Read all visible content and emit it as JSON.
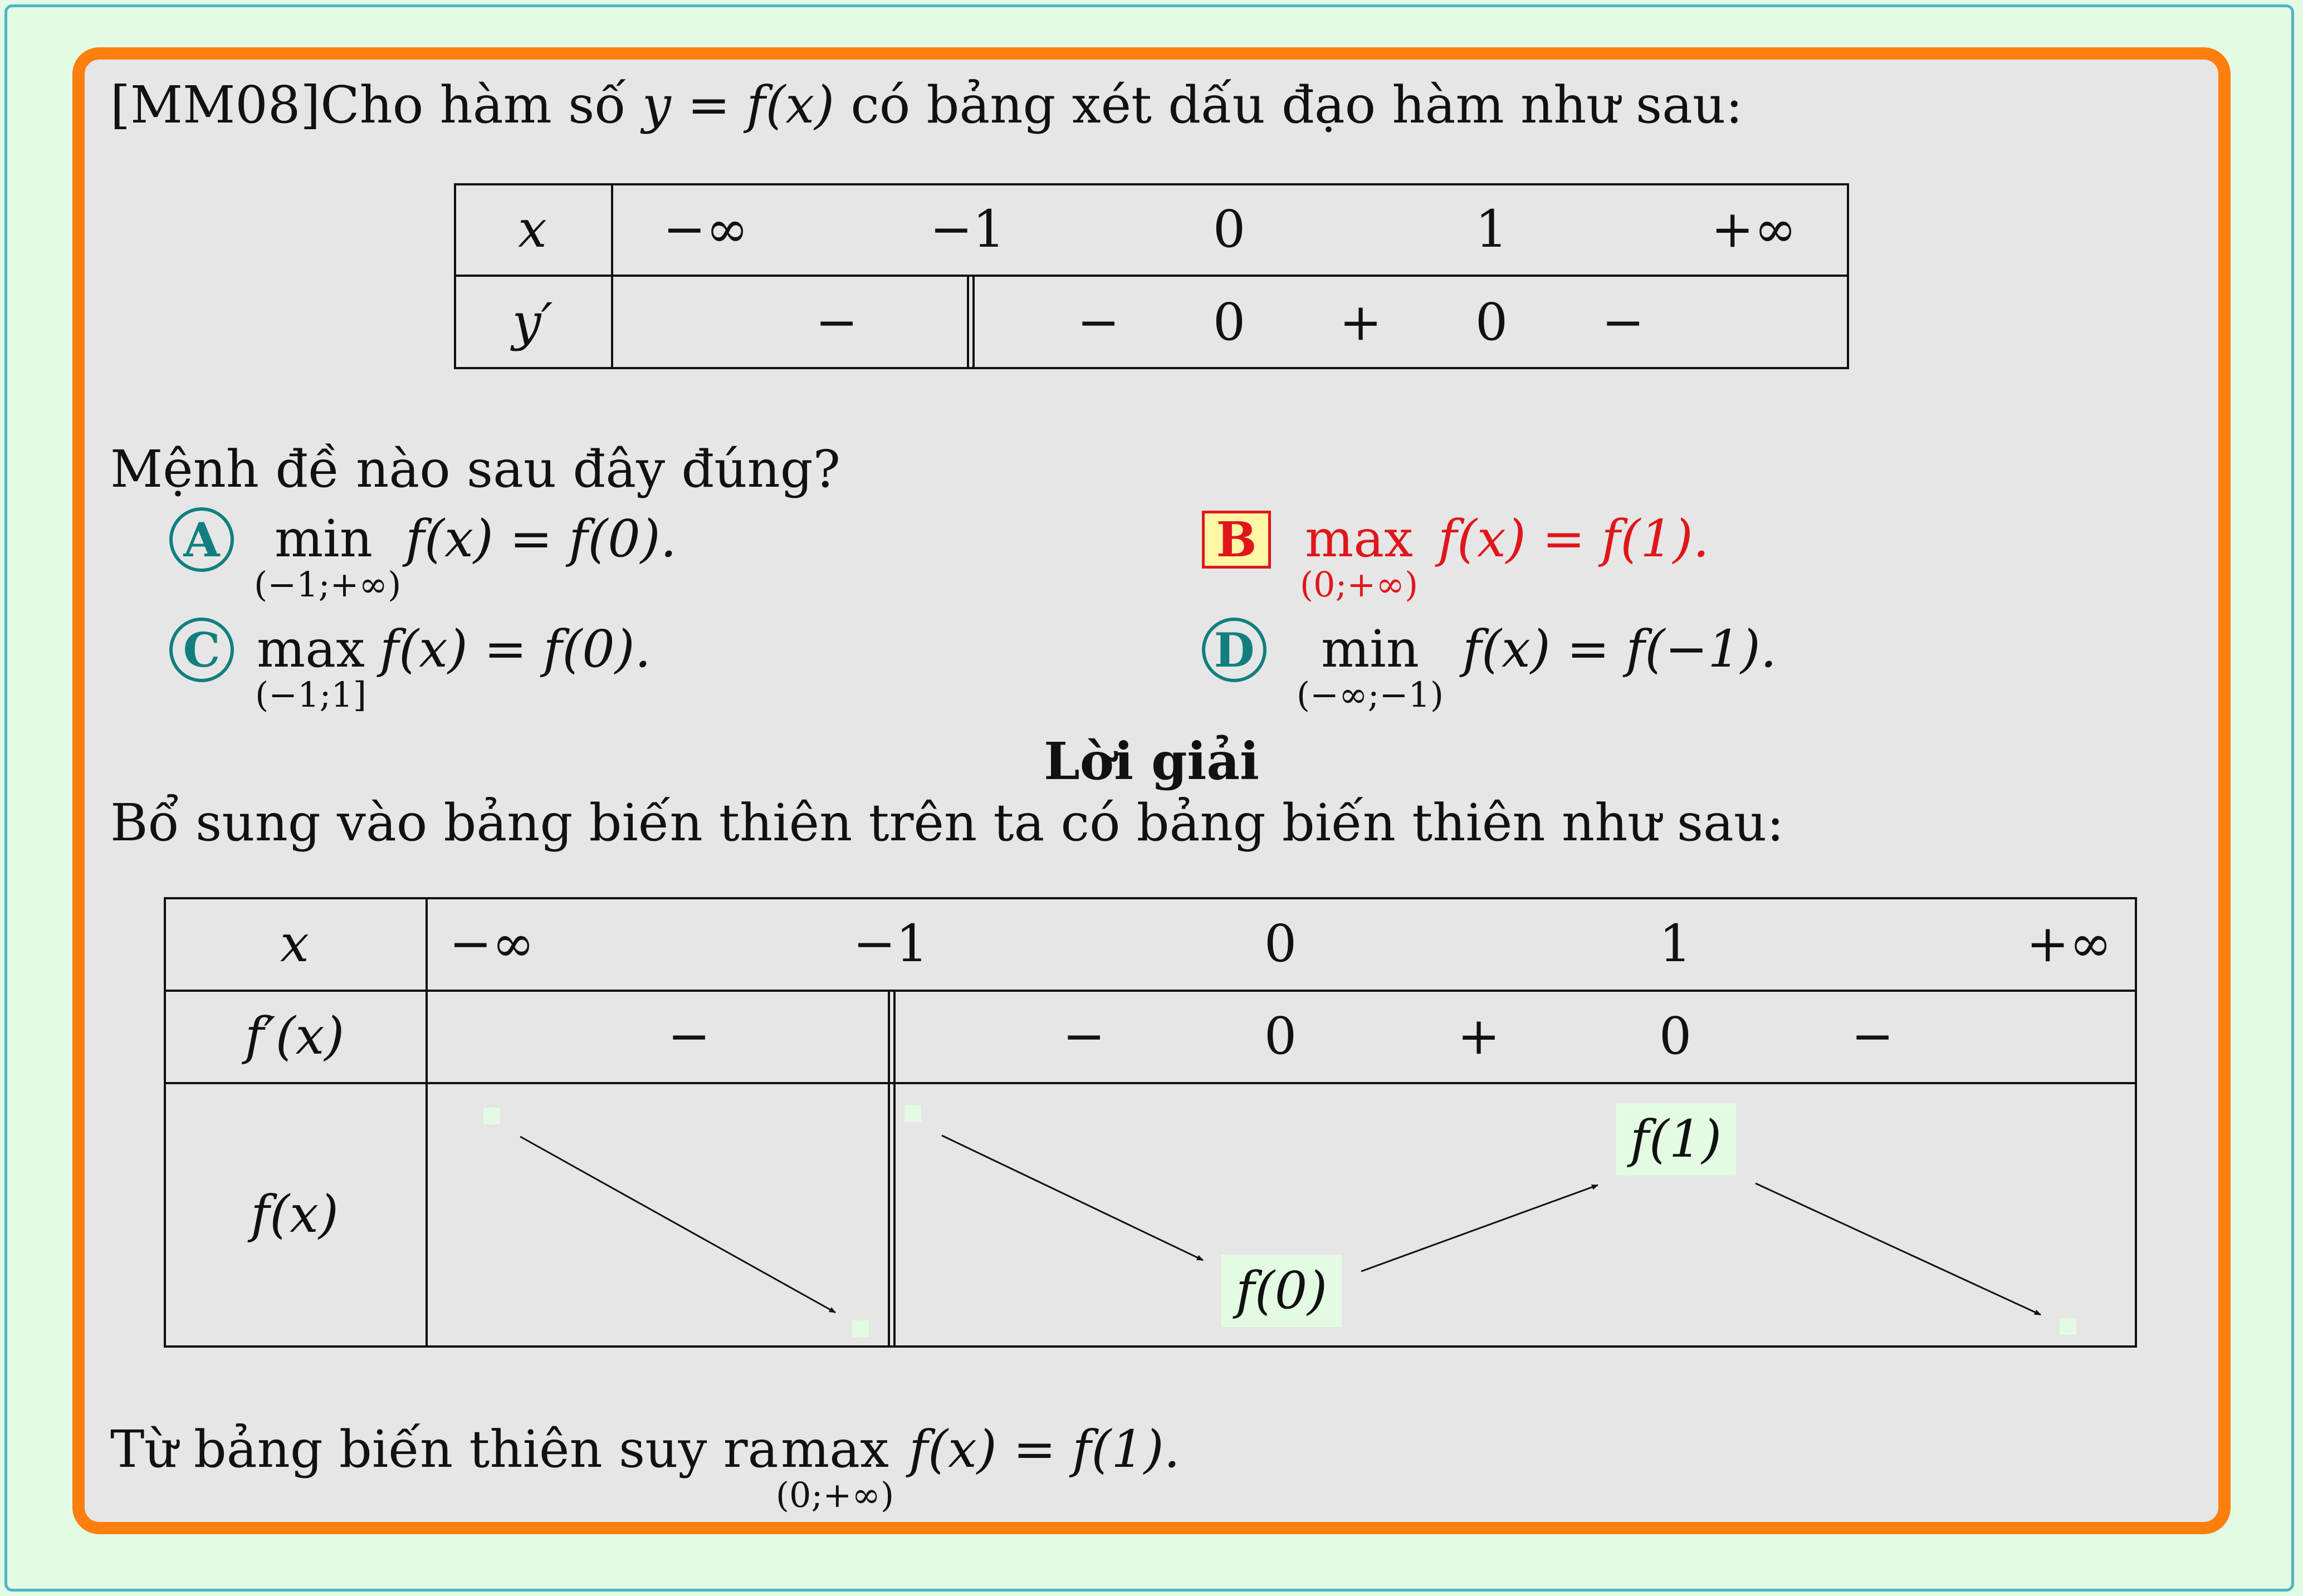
{
  "question": {
    "intro_prefix": "[MM08]Cho hàm số",
    "intro_formula": "y = f(x)",
    "intro_suffix": "có bảng xét dấu đạo hàm như sau:",
    "sign_table": {
      "row_labels": [
        "x",
        "y′"
      ],
      "x_values": [
        "−∞",
        "−1",
        "0",
        "1",
        "+∞"
      ],
      "signs": [
        "−",
        "−",
        "0",
        "+",
        "0",
        "−"
      ]
    },
    "prompt": "Mệnh đề nào sau đây đúng?"
  },
  "choices": [
    {
      "letter": "A",
      "op": "min",
      "domain": "(−1;+∞)",
      "expr": "f(x) = f(0).",
      "correct": false
    },
    {
      "letter": "B",
      "op": "max",
      "domain": "(0;+∞)",
      "expr": "f(x) = f(1).",
      "correct": true
    },
    {
      "letter": "C",
      "op": "max",
      "domain": "(−1;1]",
      "expr": "f(x) = f(0).",
      "correct": false
    },
    {
      "letter": "D",
      "op": "min",
      "domain": "(−∞;−1)",
      "expr": "f(x) = f(−1).",
      "correct": false
    }
  ],
  "solution": {
    "heading": "Lời giải",
    "intro": "Bổ sung vào bảng biến thiên trên ta có bảng biến thiên như sau:",
    "variation_table": {
      "row_labels": [
        "x",
        "f′(x)",
        "f(x)"
      ],
      "x_values": [
        "−∞",
        "−1",
        "0",
        "1",
        "+∞"
      ],
      "signs": [
        "−",
        "−",
        "0",
        "+",
        "0",
        "−"
      ],
      "nodes": [
        "f(0)",
        "f(1)"
      ]
    },
    "conclusion_prefix": "Từ bảng biến thiên suy ra",
    "conclusion_op": "max",
    "conclusion_domain": "(0;+∞)",
    "conclusion_expr": "f(x) = f(1)."
  },
  "colors": {
    "background": "#e3fae3",
    "frame": "#ff7f0e",
    "card": "#e6e6e6",
    "choice_circle": "#117f7f",
    "correct": "#e0161b",
    "correct_fill": "#fff7a5"
  }
}
